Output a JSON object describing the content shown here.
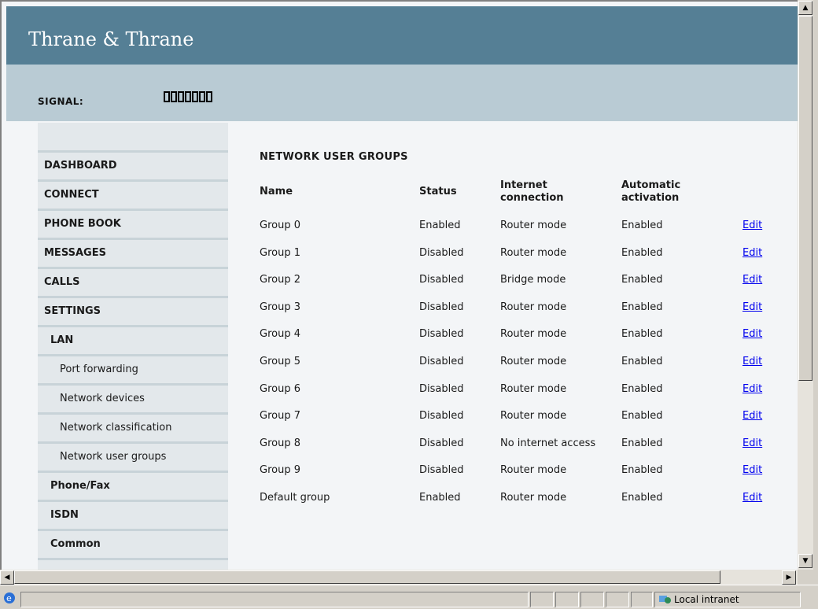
{
  "header": {
    "logo_text": "Thrane & Thrane"
  },
  "signal": {
    "label": "SIGNAL:",
    "segments": 7
  },
  "sidebar": {
    "items": [
      {
        "label": "DASHBOARD",
        "level": 0
      },
      {
        "label": "CONNECT",
        "level": 0
      },
      {
        "label": "PHONE BOOK",
        "level": 0
      },
      {
        "label": "MESSAGES",
        "level": 0
      },
      {
        "label": "CALLS",
        "level": 0
      },
      {
        "label": "SETTINGS",
        "level": 0
      },
      {
        "label": "LAN",
        "level": 1
      },
      {
        "label": "Port forwarding",
        "level": 2
      },
      {
        "label": "Network devices",
        "level": 2
      },
      {
        "label": "Network classification",
        "level": 2
      },
      {
        "label": "Network user groups",
        "level": 2
      },
      {
        "label": "Phone/Fax",
        "level": 1
      },
      {
        "label": "ISDN",
        "level": 1
      },
      {
        "label": "Common",
        "level": 1
      }
    ]
  },
  "main": {
    "title": "NETWORK USER GROUPS",
    "columns": [
      "Name",
      "Status",
      "Internet\nconnection",
      "Automatic\nactivation"
    ],
    "edit_label": "Edit",
    "rows": [
      [
        "Group 0",
        "Enabled",
        "Router mode",
        "Enabled"
      ],
      [
        "Group 1",
        "Disabled",
        "Router mode",
        "Enabled"
      ],
      [
        "Group 2",
        "Disabled",
        "Bridge mode",
        "Enabled"
      ],
      [
        "Group 3",
        "Disabled",
        "Router mode",
        "Enabled"
      ],
      [
        "Group 4",
        "Disabled",
        "Router mode",
        "Enabled"
      ],
      [
        "Group 5",
        "Disabled",
        "Router mode",
        "Enabled"
      ],
      [
        "Group 6",
        "Disabled",
        "Router mode",
        "Enabled"
      ],
      [
        "Group 7",
        "Disabled",
        "Router mode",
        "Enabled"
      ],
      [
        "Group 8",
        "Disabled",
        "No internet access",
        "Enabled"
      ],
      [
        "Group 9",
        "Disabled",
        "Router mode",
        "Enabled"
      ],
      [
        "Default group",
        "Enabled",
        "Router mode",
        "Enabled"
      ]
    ]
  },
  "statusbar": {
    "zone": "Local intranet"
  },
  "colors": {
    "header": "#557f95",
    "signal_bar": "#b9cbd4",
    "sidebar": "#e3e8eb",
    "link": "#0000ee"
  }
}
